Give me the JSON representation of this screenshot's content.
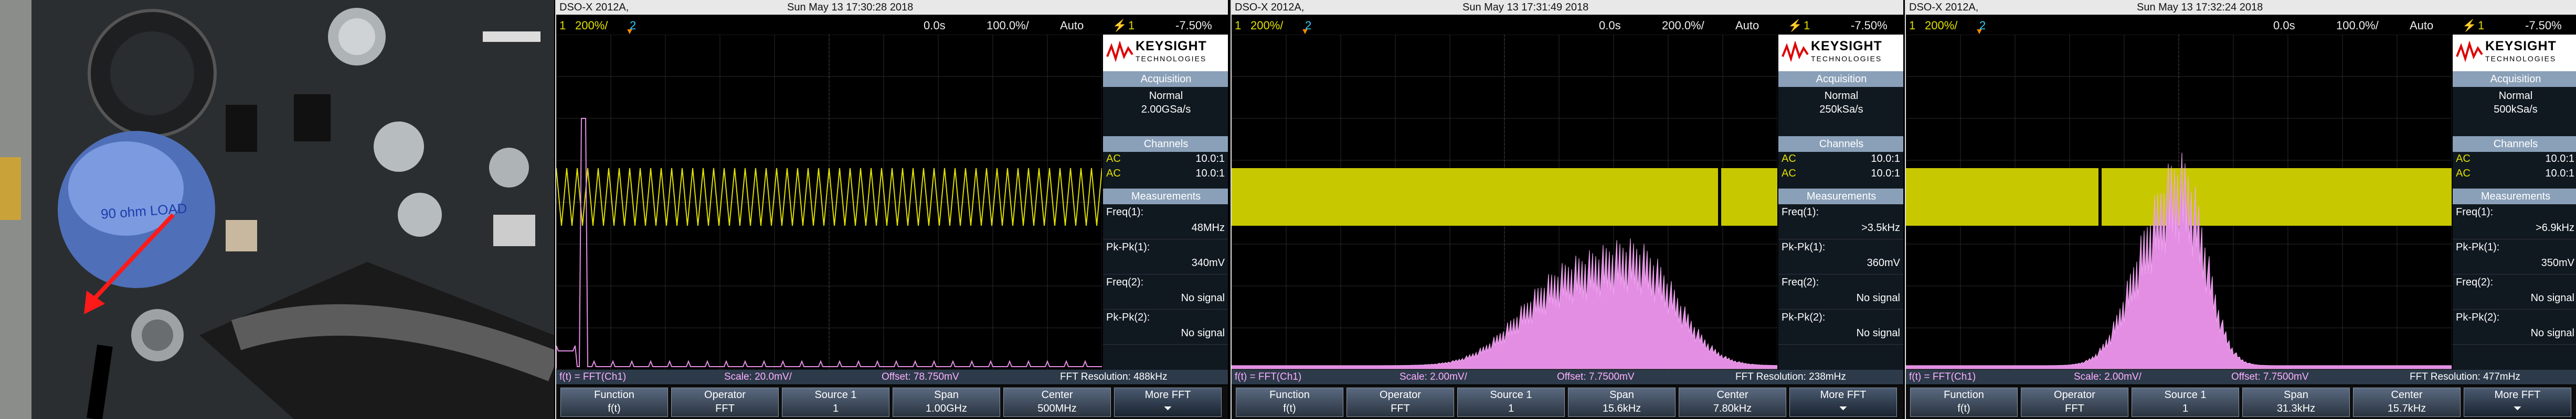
{
  "photo": {
    "load_label": "90 ohm LOAD"
  },
  "panels": [
    {
      "model": "DSO-X 2012A,",
      "datetime": "Sun May 13 17:30:28 2018",
      "ch1": "1",
      "vdiv": "200%/",
      "ch2": "2",
      "delay": "0.0s",
      "tdiv": "100.0%/",
      "mode": "Auto",
      "trig_level": "-7.50%",
      "brand": "KEYSIGHT",
      "brand_sub": "TECHNOLOGIES",
      "acq_title": "Acquisition",
      "acq_mode": "Normal",
      "acq_rate": "2.00GSa/s",
      "ch_title": "Channels",
      "ch1_cpl": "AC",
      "ch1_probe": "10.0:1",
      "ch2_cpl": "AC",
      "ch2_probe": "10.0:1",
      "meas_title": "Measurements",
      "m1_label": "Freq(1):",
      "m1_val": "48MHz",
      "m2_label": "Pk-Pk(1):",
      "m2_val": "340mV",
      "m3_label": "Freq(2):",
      "m3_val": "No signal",
      "m4_label": "Pk-Pk(2):",
      "m4_val": "No signal",
      "fx": "f(t) = FFT(Ch1)",
      "scale": "Scale: 20.0mV/",
      "offset": "Offset: 78.750mV",
      "res": "FFT Resolution: 488kHz",
      "sk1_t": "Function",
      "sk1_b": "f(t)",
      "sk2_t": "Operator",
      "sk2_b": "FFT",
      "sk3_t": "Source 1",
      "sk3_b": "1",
      "sk4_t": "Span",
      "sk4_b": "1.00GHz",
      "sk5_t": "Center",
      "sk5_b": "500MHz",
      "sk6_t": "More FFT"
    },
    {
      "model": "DSO-X 2012A,",
      "datetime": "Sun May 13 17:31:49 2018",
      "ch1": "1",
      "vdiv": "200%/",
      "ch2": "2",
      "delay": "0.0s",
      "tdiv": "200.0%/",
      "mode": "Auto",
      "trig_level": "-7.50%",
      "brand": "KEYSIGHT",
      "brand_sub": "TECHNOLOGIES",
      "acq_title": "Acquisition",
      "acq_mode": "Normal",
      "acq_rate": "250kSa/s",
      "ch_title": "Channels",
      "ch1_cpl": "AC",
      "ch1_probe": "10.0:1",
      "ch2_cpl": "AC",
      "ch2_probe": "10.0:1",
      "meas_title": "Measurements",
      "m1_label": "Freq(1):",
      "m1_val": ">3.5kHz",
      "m2_label": "Pk-Pk(1):",
      "m2_val": "360mV",
      "m3_label": "Freq(2):",
      "m3_val": "No signal",
      "m4_label": "Pk-Pk(2):",
      "m4_val": "No signal",
      "fx": "f(t) = FFT(Ch1)",
      "scale": "Scale: 2.00mV/",
      "offset": "Offset: 7.7500mV",
      "res": "FFT Resolution: 238mHz",
      "sk1_t": "Function",
      "sk1_b": "f(t)",
      "sk2_t": "Operator",
      "sk2_b": "FFT",
      "sk3_t": "Source 1",
      "sk3_b": "1",
      "sk4_t": "Span",
      "sk4_b": "15.6kHz",
      "sk5_t": "Center",
      "sk5_b": "7.80kHz",
      "sk6_t": "More FFT"
    },
    {
      "model": "DSO-X 2012A,",
      "datetime": "Sun May 13 17:32:24 2018",
      "ch1": "1",
      "vdiv": "200%/",
      "ch2": "2",
      "delay": "0.0s",
      "tdiv": "100.0%/",
      "mode": "Auto",
      "trig_level": "-7.50%",
      "brand": "KEYSIGHT",
      "brand_sub": "TECHNOLOGIES",
      "acq_title": "Acquisition",
      "acq_mode": "Normal",
      "acq_rate": "500kSa/s",
      "ch_title": "Channels",
      "ch1_cpl": "AC",
      "ch1_probe": "10.0:1",
      "ch2_cpl": "AC",
      "ch2_probe": "10.0:1",
      "meas_title": "Measurements",
      "m1_label": "Freq(1):",
      "m1_val": ">6.9kHz",
      "m2_label": "Pk-Pk(1):",
      "m2_val": "350mV",
      "m3_label": "Freq(2):",
      "m3_val": "No signal",
      "m4_label": "Pk-Pk(2):",
      "m4_val": "No signal",
      "fx": "f(t) = FFT(Ch1)",
      "scale": "Scale: 2.00mV/",
      "offset": "Offset: 7.7500mV",
      "res": "FFT Resolution: 477mHz",
      "sk1_t": "Function",
      "sk1_b": "f(t)",
      "sk2_t": "Operator",
      "sk2_b": "FFT",
      "sk3_t": "Source 1",
      "sk3_b": "1",
      "sk4_t": "Span",
      "sk4_b": "31.3kHz",
      "sk5_t": "Center",
      "sk5_b": "15.7kHz",
      "sk6_t": "More FFT"
    }
  ]
}
